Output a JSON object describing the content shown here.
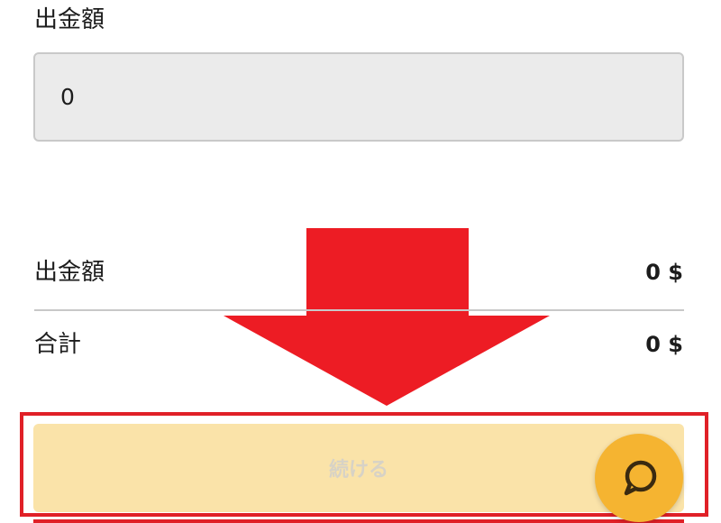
{
  "form": {
    "amount_label": "出金額",
    "amount_value": "0"
  },
  "summary": {
    "amount_label": "出金額",
    "amount_value": "0 $",
    "total_label": "合計",
    "total_value": "0 $"
  },
  "continue_button": {
    "label": "続ける",
    "state": "disabled"
  },
  "annotation": {
    "arrow_color": "#ED1C24",
    "highlight_color": "#E02027"
  },
  "chat": {
    "icon": "chat-bubble-icon",
    "color": "#F5B431"
  }
}
